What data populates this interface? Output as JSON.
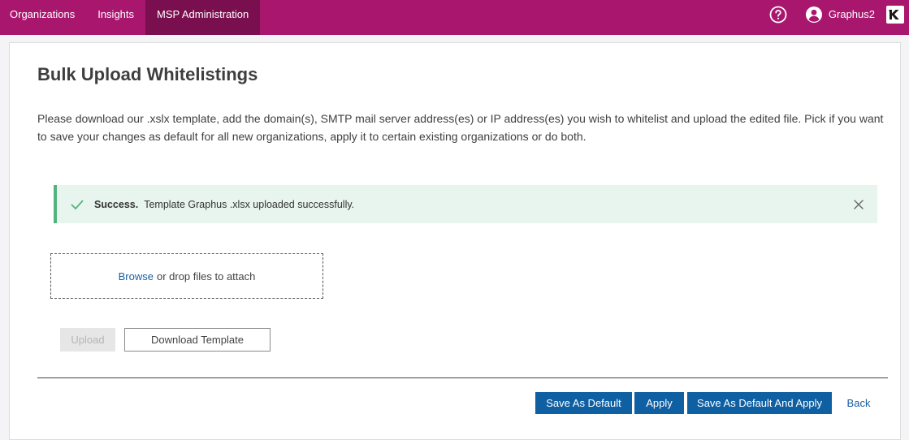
{
  "nav": {
    "items": [
      {
        "label": "Organizations"
      },
      {
        "label": "Insights"
      },
      {
        "label": "MSP Administration"
      }
    ],
    "user_name": "Graphus2"
  },
  "page": {
    "title": "Bulk Upload Whitelistings",
    "description": "Please download our .xslx template, add the domain(s), SMTP mail server address(es) or IP address(es) you wish to whitelist and upload the edited file. Pick if you want to save your changes as default for all new organizations, apply it to certain existing organizations or do both."
  },
  "alert": {
    "title": "Success.",
    "message": "Template Graphus .xlsx uploaded successfully.",
    "color": "#52b37e"
  },
  "dropzone": {
    "browse_label": "Browse",
    "text": "or drop files to attach"
  },
  "buttons": {
    "upload": "Upload",
    "download_template": "Download Template",
    "save_as_default": "Save As Default",
    "apply": "Apply",
    "save_as_default_and_apply": "Save As Default And Apply",
    "back": "Back"
  },
  "colors": {
    "brand": "#a9166e",
    "nav_active": "#7a0f4f",
    "primary": "#0f5fa3"
  },
  "icons": {
    "help": "question-circle-icon",
    "user": "user-circle-icon",
    "logo": "kaseya-k-logo",
    "check": "check-icon",
    "close": "close-icon"
  }
}
